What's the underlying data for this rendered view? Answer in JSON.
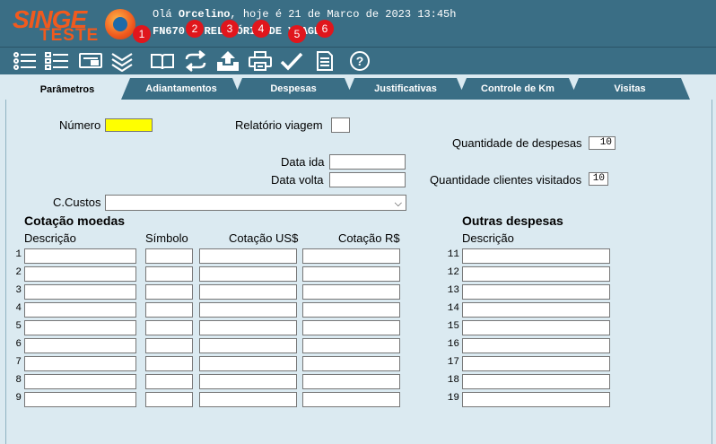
{
  "header": {
    "logo_singe": "SINGE",
    "logo_teste": "TESTE",
    "greeting_prefix": "Olá ",
    "user": "Orcelino",
    "greeting_suffix": ", hoje é 21 de Marco de 2023 13:45h",
    "form_title": "FN670 - RELATÓRIO DE VIAGEM"
  },
  "toolbar": {
    "icons": [
      "list-icon",
      "checklist-icon",
      "card-icon",
      "expand-all-icon",
      "book-icon",
      "refresh-icon",
      "upload-icon",
      "print-icon",
      "check-icon",
      "document-icon",
      "help-icon"
    ],
    "badges": [
      "1",
      "2",
      "3",
      "4",
      "5",
      "6"
    ]
  },
  "tabs": [
    "Parâmetros",
    "Adiantamentos",
    "Despesas",
    "Justificativas",
    "Controle de Km",
    "Visitas"
  ],
  "active_tab": "Parâmetros",
  "form": {
    "numero_label": "Número",
    "numero_value": "",
    "relatorio_label": "Relatório viagem",
    "qtd_despesas_label": "Quantidade de despesas",
    "qtd_despesas_value": "10",
    "data_ida_label": "Data ida",
    "data_volta_label": "Data volta",
    "qtd_clientes_label": "Quantidade clientes visitados",
    "qtd_clientes_value": "10",
    "ccustos_label": "C.Custos"
  },
  "cotacao": {
    "title": "Cotação moedas",
    "headers": [
      "Descrição",
      "Símbolo",
      "Cotação US$",
      "Cotação R$"
    ],
    "rows": [
      "1",
      "2",
      "3",
      "4",
      "5",
      "6",
      "7",
      "8",
      "9"
    ]
  },
  "outras": {
    "title": "Outras despesas",
    "header": "Descrição",
    "rows": [
      "11",
      "12",
      "13",
      "14",
      "15",
      "16",
      "17",
      "18",
      "19"
    ]
  },
  "colors": {
    "header_bg": "#3a6e85",
    "content_bg": "#dbeaf1",
    "logo": "#f05a1e",
    "badge": "#e0161c",
    "highlight": "#ffff00"
  }
}
